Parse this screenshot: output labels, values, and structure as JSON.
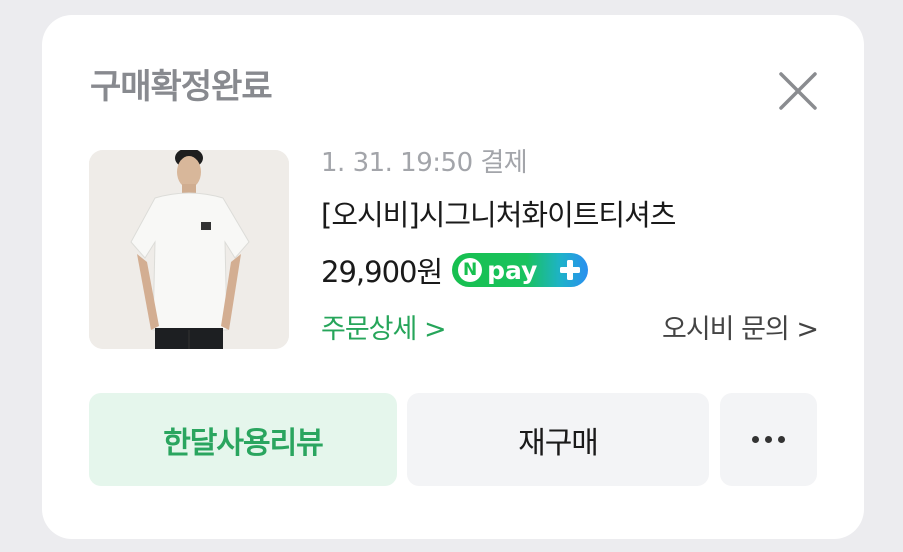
{
  "header": {
    "title": "구매확정완료"
  },
  "order": {
    "meta": "1. 31. 19:50 결제",
    "product_name": "[오시비]시그니처화이트티셔츠",
    "price": "29,900원",
    "npay": {
      "n": "N",
      "text": "pay"
    },
    "order_detail_link": "주문상세 >",
    "seller_inquiry_link": "오시비 문의 >"
  },
  "actions": {
    "review_label": "한달사용리뷰",
    "rebuy_label": "재구매"
  },
  "colors": {
    "accent_green": "#26a55a",
    "review_bg": "#e5f6ec",
    "title_gray": "#888a8f"
  },
  "icons": [
    "close-icon",
    "npay-plus-icon",
    "more-dots-icon"
  ]
}
